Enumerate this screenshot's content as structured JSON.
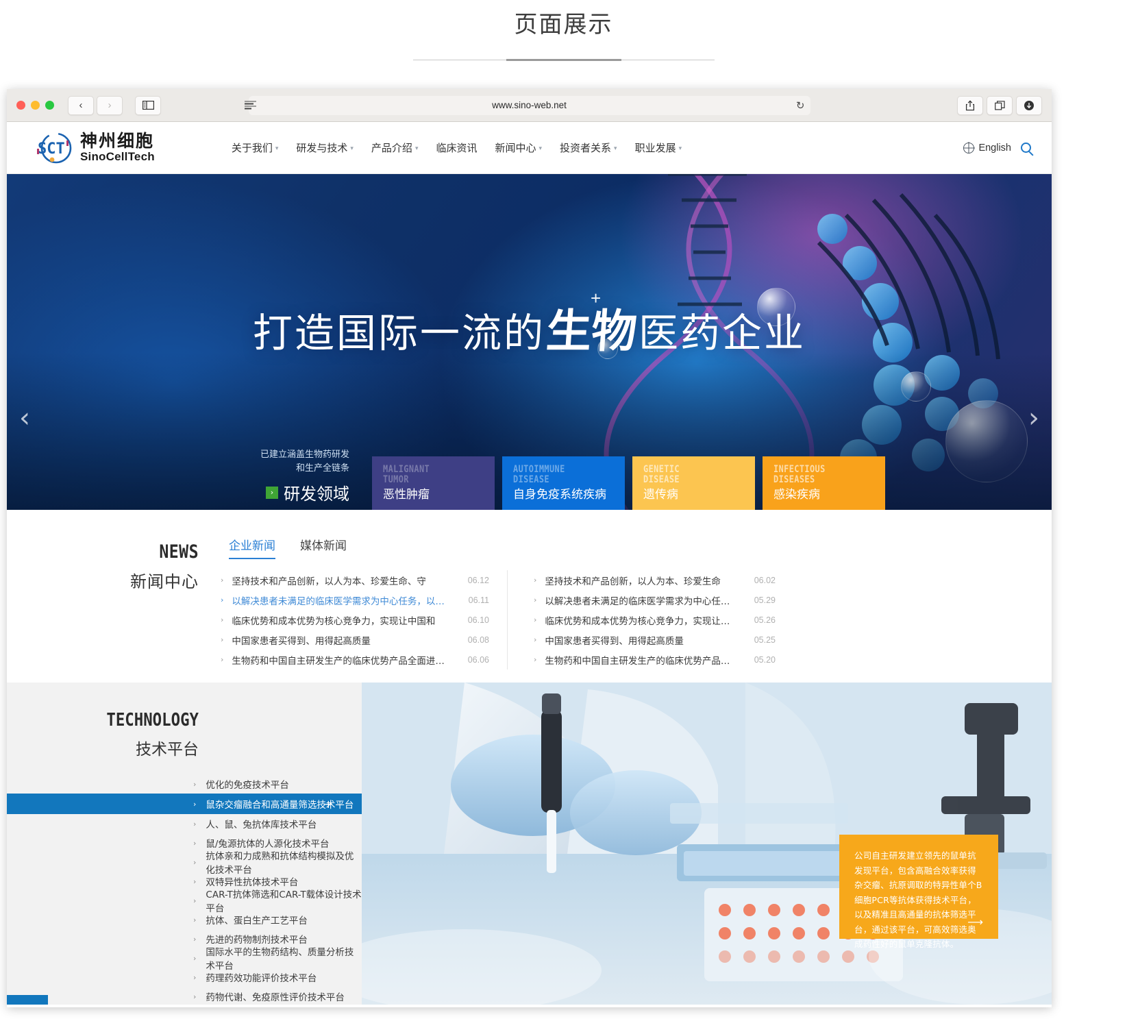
{
  "caption": {
    "text": "页面展示"
  },
  "browser": {
    "url": "www.sino-web.net",
    "traffic": {
      "close": "close-button",
      "minimize": "minimize-button",
      "zoom": "zoom-button"
    },
    "buttons": {
      "back": "‹",
      "forward": "›",
      "sidebar": "sidebar-toggle",
      "share": "share-button",
      "tabs": "tab-overview-button",
      "download": "downloads-button",
      "reload": "↻"
    }
  },
  "site": {
    "logo": {
      "cn": "神州细胞",
      "en": "SinoCellTech",
      "abbr": "SCT"
    },
    "nav": [
      {
        "label": "关于我们",
        "has_dropdown": true
      },
      {
        "label": "研发与技术",
        "has_dropdown": true
      },
      {
        "label": "产品介绍",
        "has_dropdown": true
      },
      {
        "label": "临床资讯",
        "has_dropdown": false
      },
      {
        "label": "新闻中心",
        "has_dropdown": true
      },
      {
        "label": "投资者关系",
        "has_dropdown": true
      },
      {
        "label": "职业发展",
        "has_dropdown": true
      }
    ],
    "language": "English"
  },
  "hero": {
    "title_prefix": "打造国际一流的",
    "title_accent": "生物",
    "title_suffix": "医药企业",
    "title_plus": "+",
    "arrow_left": "‹",
    "arrow_right": "›",
    "field_sub_line1": "已建立涵盖生物药研发",
    "field_sub_line2": "和生产全链条",
    "field_main": "研发领域",
    "field_chevron": "›",
    "cards": [
      {
        "en": "MALIGNANT\nTUMOR",
        "cn": "恶性肿瘤",
        "color": "#3e3f85"
      },
      {
        "en": "AUTOIMMUNE\nDISEASE",
        "cn": "自身免疫系统疾病",
        "color": "#0b6fd8"
      },
      {
        "en": "GENETIC\nDISEASE",
        "cn": "遗传病",
        "color": "#fcc550"
      },
      {
        "en": "INFECTIOUS\nDISEASES",
        "cn": "感染疾病",
        "color": "#f9a21b"
      }
    ]
  },
  "news": {
    "heading_en": "NEWS",
    "heading_cn": "新闻中心",
    "tabs": [
      {
        "label": "企业新闻",
        "active": true
      },
      {
        "label": "媒体新闻",
        "active": false
      }
    ],
    "left_items": [
      {
        "title": "坚持技术和产品创新，以人为本、珍爱生命、守",
        "date": "06.12",
        "highlighted": false
      },
      {
        "title": "以解决患者未满足的临床医学需求为中心任务，以产品",
        "date": "06.11",
        "highlighted": true
      },
      {
        "title": "临床优势和成本优势为核心竞争力，实现让中国和",
        "date": "06.10",
        "highlighted": false
      },
      {
        "title": "中国家患者买得到、用得起高质量",
        "date": "06.08",
        "highlighted": false
      },
      {
        "title": "生物药和中国自主研发生产的临床优势产品全面进入发达国",
        "date": "06.06",
        "highlighted": false
      }
    ],
    "right_items": [
      {
        "title": "坚持技术和产品创新，以人为本、珍爱生命",
        "date": "06.02",
        "highlighted": false
      },
      {
        "title": "以解决患者未满足的临床医学需求为中心任务，以产",
        "date": "05.29",
        "highlighted": false
      },
      {
        "title": "临床优势和成本优势为核心竞争力，实现让中国",
        "date": "05.26",
        "highlighted": false
      },
      {
        "title": "中国家患者买得到、用得起高质量",
        "date": "05.25",
        "highlighted": false
      },
      {
        "title": "生物药和中国自主研发生产的临床优势产品全面进入发",
        "date": "05.20",
        "highlighted": false
      }
    ]
  },
  "technology": {
    "heading_en": "TECHNOLOGY",
    "heading_cn": "技术平台",
    "items": [
      {
        "label": "优化的免疫技术平台",
        "active": false
      },
      {
        "label": "鼠杂交瘤融合和高通量筛选技术平台",
        "active": true
      },
      {
        "label": "人、鼠、兔抗体库技术平台",
        "active": false
      },
      {
        "label": "鼠/兔源抗体的人源化技术平台",
        "active": false
      },
      {
        "label": "抗体亲和力成熟和抗体结构模拟及优化技术平台",
        "active": false
      },
      {
        "label": "双特异性抗体技术平台",
        "active": false
      },
      {
        "label": "CAR-T抗体筛选和CAR-T载体设计技术平台",
        "active": false
      },
      {
        "label": "抗体、蛋白生产工艺平台",
        "active": false
      },
      {
        "label": "先进的药物制剂技术平台",
        "active": false
      },
      {
        "label": "国际水平的生物药结构、质量分析技术平台",
        "active": false
      },
      {
        "label": "药理药效功能评价技术平台",
        "active": false
      },
      {
        "label": "药物代谢、免疫原性评价技术平台",
        "active": false
      }
    ],
    "active_plus": "+",
    "info_card": {
      "text": "公司自主研发建立领先的鼠单抗发现平台，包含高融合效率获得杂交瘤、抗原调取的特异性单个B细胞PCR等抗体获得技术平台，以及精准且高通量的抗体筛选平台，通过该平台，可高效筛选奥成药性好的鼠单克隆抗体。",
      "more": "⟶",
      "color": "#f7a81b"
    }
  },
  "colors": {
    "accent_blue": "#1277bd",
    "link_blue": "#3f8ad6",
    "orange": "#f7a81b",
    "green": "#3fa535"
  }
}
